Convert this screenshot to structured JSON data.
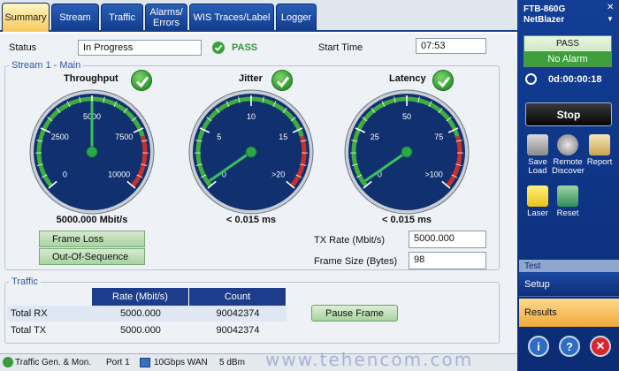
{
  "tabs": [
    "Summary",
    "Stream",
    "Traffic",
    "Alarms/\nErrors",
    "WIS Traces/Label",
    "Logger"
  ],
  "status": {
    "label": "Status",
    "value": "In Progress",
    "verdict": "PASS",
    "start_time_label": "Start Time",
    "start_time": "07:53"
  },
  "stream": {
    "title": "Stream 1 - Main",
    "gauges": [
      {
        "title": "Throughput",
        "ticks": [
          "0",
          "2500",
          "5000",
          "7500",
          "10000"
        ],
        "value_text": "5000.000 Mbit/s",
        "needle_fraction": 0.5
      },
      {
        "title": "Jitter",
        "ticks": [
          "0",
          "5",
          "10",
          "15",
          ">20"
        ],
        "value_text": "< 0.015 ms",
        "needle_fraction": 0.02
      },
      {
        "title": "Latency",
        "ticks": [
          "0",
          "25",
          "50",
          "75",
          ">100"
        ],
        "value_text": "< 0.015 ms",
        "needle_fraction": 0.02
      }
    ],
    "indicators": [
      "Frame Loss",
      "Out-Of-Sequence"
    ],
    "tx_rate_label": "TX Rate (Mbit/s)",
    "tx_rate": "5000.000",
    "frame_size_label": "Frame Size (Bytes)",
    "frame_size": "98"
  },
  "traffic": {
    "title": "Traffic",
    "headers": [
      "Rate (Mbit/s)",
      "Count"
    ],
    "rows": [
      {
        "label": "Total RX",
        "rate": "5000.000",
        "count": "90042374"
      },
      {
        "label": "Total TX",
        "rate": "5000.000",
        "count": "90042374"
      }
    ],
    "pause_label": "Pause Frame"
  },
  "statusbar": {
    "mode": "Traffic Gen. & Mon.",
    "port": "Port 1",
    "link": "10Gbps WAN",
    "power": "5 dBm"
  },
  "side": {
    "device_line1": "FTB-860G",
    "device_line2": "NetBlazer",
    "pass_label": "PASS",
    "alarm_label": "No Alarm",
    "timer": "0d:00:00:18",
    "stop_label": "Stop",
    "tools": [
      {
        "label": "Save\nLoad",
        "icon": "save-load-icon"
      },
      {
        "label": "Remote\nDiscover",
        "icon": "remote-discover-icon"
      },
      {
        "label": "Report",
        "icon": "report-icon"
      },
      {
        "label": "Laser",
        "icon": "laser-icon"
      },
      {
        "label": "Reset",
        "icon": "reset-icon"
      }
    ],
    "test_header": "Test",
    "setup_label": "Setup",
    "results_label": "Results"
  },
  "watermark": "www.tehencom.com",
  "colors": {
    "accent": "#123e96",
    "pass_green": "#3d9f3d",
    "active_tab": "#f6c75a",
    "needle": "#2fa84f"
  }
}
